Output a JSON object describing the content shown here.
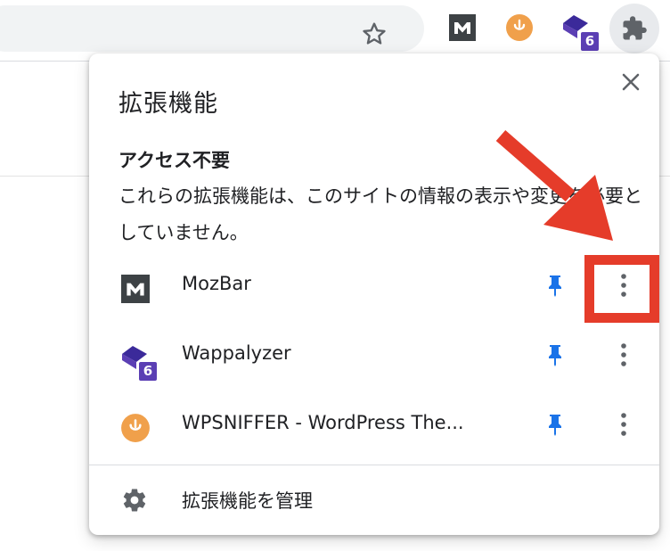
{
  "popup": {
    "title": "拡張機能",
    "section_heading": "アクセス不要",
    "section_description": "これらの拡張機能は、このサイトの情報の表示や変更を必要としていません。",
    "extensions": [
      {
        "name": "MozBar",
        "icon": "mozbar-icon",
        "pinned": true
      },
      {
        "name": "Wappalyzer",
        "icon": "wappalyzer-icon",
        "badge": "6",
        "pinned": true
      },
      {
        "name": "WPSNIFFER - WordPress The...",
        "icon": "wpsniffer-icon",
        "pinned": true
      }
    ],
    "manage_label": "拡張機能を管理"
  },
  "toolbar": {
    "wappalyzer_badge": "6"
  },
  "colors": {
    "pin_blue": "#1a73e8",
    "annotation_red": "#e53c2a",
    "wappalyzer_purple": "#5b3fb4",
    "wpsniffer_orange": "#f0a04b"
  }
}
